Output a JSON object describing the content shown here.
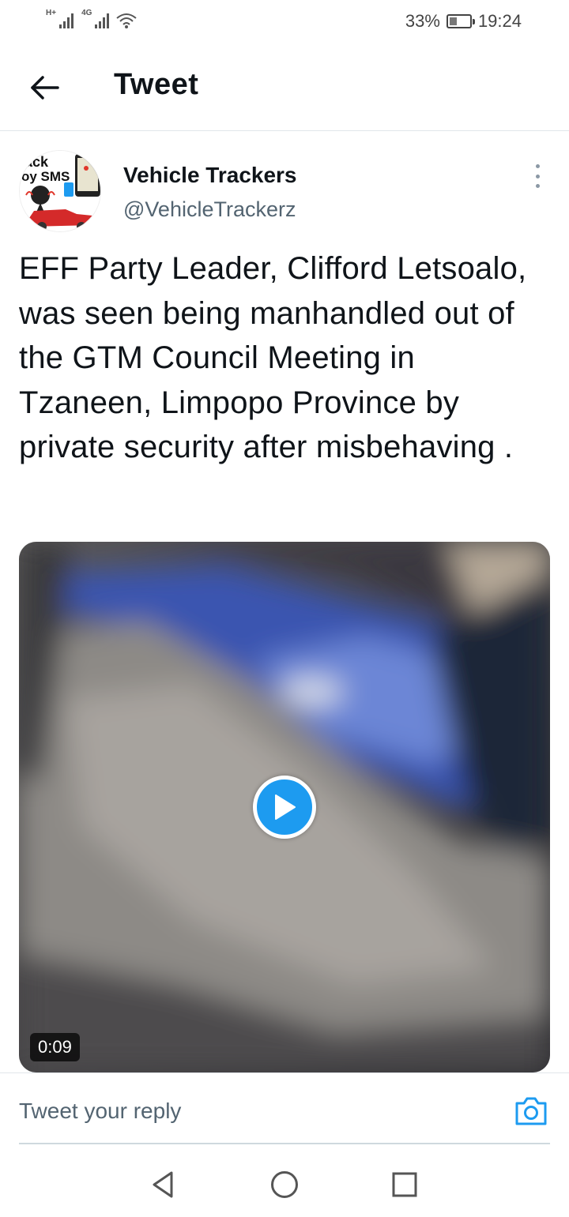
{
  "status_bar": {
    "signal1_label": "H+",
    "signal2_label": "4G",
    "battery_percent": "33%",
    "battery_level": 0.33,
    "time": "19:24"
  },
  "header": {
    "title": "Tweet",
    "back_icon": "arrow-left-icon"
  },
  "tweet": {
    "author_name": "Vehicle Trackers",
    "author_handle": "@VehicleTrackerz",
    "avatar_text_line1": "ack",
    "avatar_text_line2": "oy SMS",
    "text": "EFF Party Leader, Clifford Letsoalo, was seen being manhandled out of the GTM Council Meeting in Tzaneen, Limpopo Province by private security after misbehaving .",
    "video_duration": "0:09"
  },
  "reply": {
    "placeholder": "Tweet your reply",
    "camera_icon": "camera-icon"
  },
  "colors": {
    "accent": "#1d9bf0",
    "text_primary": "#0f1419",
    "text_secondary": "#536471"
  },
  "nav": {
    "back_icon": "triangle-back-icon",
    "home_icon": "circle-home-icon",
    "recents_icon": "square-recents-icon"
  }
}
